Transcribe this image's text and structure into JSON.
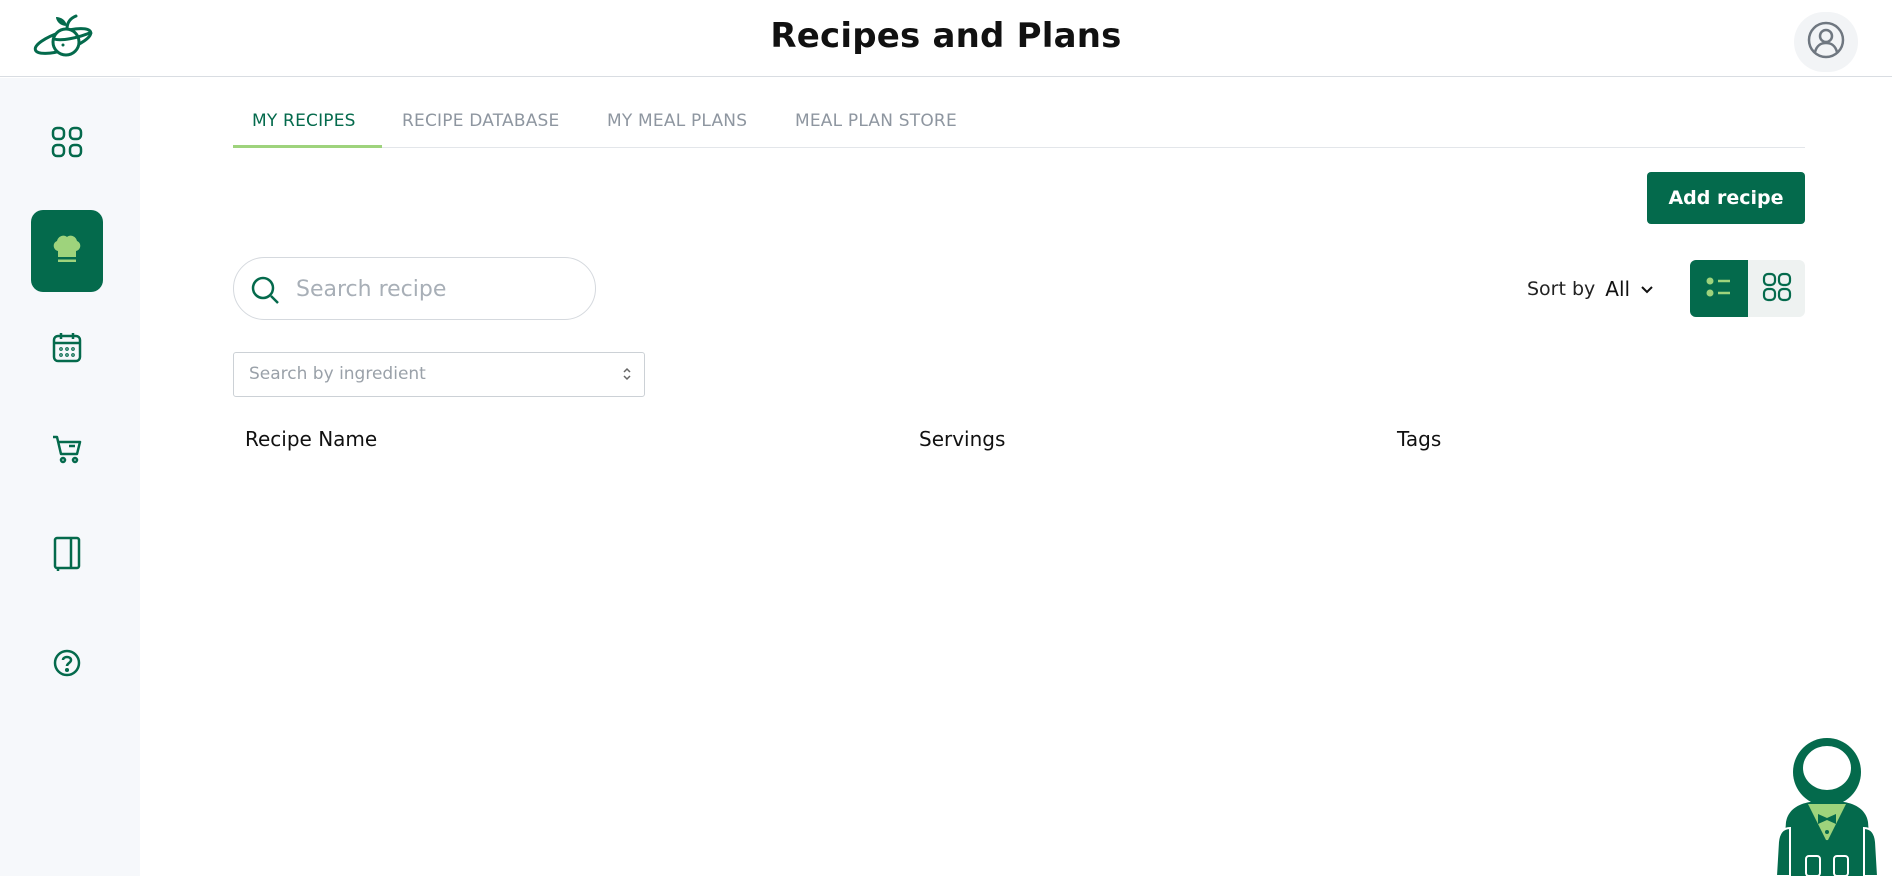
{
  "header": {
    "title": "Recipes and Plans",
    "logo_icon": "planet-apple-logo-icon",
    "profile_icon": "user-circle-icon"
  },
  "sidebar": {
    "items": [
      {
        "icon": "dashboard-grid-icon",
        "active": false
      },
      {
        "icon": "chef-hat-icon",
        "active": true
      },
      {
        "icon": "calendar-icon",
        "active": false
      },
      {
        "icon": "shopping-cart-icon",
        "active": false
      },
      {
        "icon": "notebook-icon",
        "active": false
      },
      {
        "icon": "help-circle-icon",
        "active": false
      }
    ]
  },
  "tabs": [
    {
      "label": "MY RECIPES",
      "active": true
    },
    {
      "label": "RECIPE DATABASE",
      "active": false
    },
    {
      "label": "MY MEAL PLANS",
      "active": false
    },
    {
      "label": "MEAL PLAN STORE",
      "active": false
    }
  ],
  "toolbar": {
    "add_label": "Add recipe",
    "search_placeholder": "Search recipe",
    "sort_label": "Sort by",
    "sort_value": "All",
    "ingredient_placeholder": "Search by ingredient",
    "view_mode": "list"
  },
  "table": {
    "columns": [
      "Recipe Name",
      "Servings",
      "Tags"
    ],
    "rows": []
  },
  "colors": {
    "brand": "#046a4c",
    "accent": "#9ed37c",
    "tab_inactive": "#8e96a0",
    "sidebar_bg": "#f6f8fb"
  }
}
